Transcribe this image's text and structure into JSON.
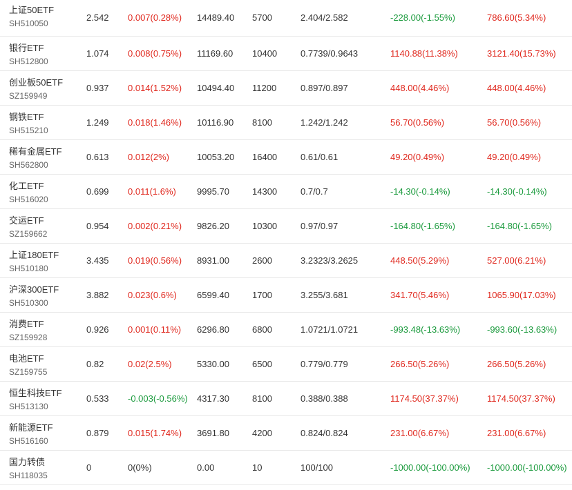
{
  "holdings": [
    {
      "name": "上证50ETF",
      "code": "SH510050",
      "price": "2.542",
      "change": "0.007(0.28%)",
      "change_dir": "up",
      "market_value": "14489.40",
      "quantity": "5700",
      "cost": "2.404/2.582",
      "profit_today": "-228.00(-1.55%)",
      "profit_today_dir": "down",
      "profit_total": "786.60(5.34%)",
      "profit_total_dir": "up"
    },
    {
      "name": "银行ETF",
      "code": "SH512800",
      "price": "1.074",
      "change": "0.008(0.75%)",
      "change_dir": "up",
      "market_value": "11169.60",
      "quantity": "10400",
      "cost": "0.7739/0.9643",
      "profit_today": "1140.88(11.38%)",
      "profit_today_dir": "up",
      "profit_total": "3121.40(15.73%)",
      "profit_total_dir": "up"
    },
    {
      "name": "创业板50ETF",
      "code": "SZ159949",
      "price": "0.937",
      "change": "0.014(1.52%)",
      "change_dir": "up",
      "market_value": "10494.40",
      "quantity": "11200",
      "cost": "0.897/0.897",
      "profit_today": "448.00(4.46%)",
      "profit_today_dir": "up",
      "profit_total": "448.00(4.46%)",
      "profit_total_dir": "up"
    },
    {
      "name": "钢铁ETF",
      "code": "SH515210",
      "price": "1.249",
      "change": "0.018(1.46%)",
      "change_dir": "up",
      "market_value": "10116.90",
      "quantity": "8100",
      "cost": "1.242/1.242",
      "profit_today": "56.70(0.56%)",
      "profit_today_dir": "up",
      "profit_total": "56.70(0.56%)",
      "profit_total_dir": "up"
    },
    {
      "name": "稀有金属ETF",
      "code": "SH562800",
      "price": "0.613",
      "change": "0.012(2%)",
      "change_dir": "up",
      "market_value": "10053.20",
      "quantity": "16400",
      "cost": "0.61/0.61",
      "profit_today": "49.20(0.49%)",
      "profit_today_dir": "up",
      "profit_total": "49.20(0.49%)",
      "profit_total_dir": "up"
    },
    {
      "name": "化工ETF",
      "code": "SH516020",
      "price": "0.699",
      "change": "0.011(1.6%)",
      "change_dir": "up",
      "market_value": "9995.70",
      "quantity": "14300",
      "cost": "0.7/0.7",
      "profit_today": "-14.30(-0.14%)",
      "profit_today_dir": "down",
      "profit_total": "-14.30(-0.14%)",
      "profit_total_dir": "down"
    },
    {
      "name": "交运ETF",
      "code": "SZ159662",
      "price": "0.954",
      "change": "0.002(0.21%)",
      "change_dir": "up",
      "market_value": "9826.20",
      "quantity": "10300",
      "cost": "0.97/0.97",
      "profit_today": "-164.80(-1.65%)",
      "profit_today_dir": "down",
      "profit_total": "-164.80(-1.65%)",
      "profit_total_dir": "down"
    },
    {
      "name": "上证180ETF",
      "code": "SH510180",
      "price": "3.435",
      "change": "0.019(0.56%)",
      "change_dir": "up",
      "market_value": "8931.00",
      "quantity": "2600",
      "cost": "3.2323/3.2625",
      "profit_today": "448.50(5.29%)",
      "profit_today_dir": "up",
      "profit_total": "527.00(6.21%)",
      "profit_total_dir": "up"
    },
    {
      "name": "沪深300ETF",
      "code": "SH510300",
      "price": "3.882",
      "change": "0.023(0.6%)",
      "change_dir": "up",
      "market_value": "6599.40",
      "quantity": "1700",
      "cost": "3.255/3.681",
      "profit_today": "341.70(5.46%)",
      "profit_today_dir": "up",
      "profit_total": "1065.90(17.03%)",
      "profit_total_dir": "up"
    },
    {
      "name": "消费ETF",
      "code": "SZ159928",
      "price": "0.926",
      "change": "0.001(0.11%)",
      "change_dir": "up",
      "market_value": "6296.80",
      "quantity": "6800",
      "cost": "1.0721/1.0721",
      "profit_today": "-993.48(-13.63%)",
      "profit_today_dir": "down",
      "profit_total": "-993.60(-13.63%)",
      "profit_total_dir": "down"
    },
    {
      "name": "电池ETF",
      "code": "SZ159755",
      "price": "0.82",
      "change": "0.02(2.5%)",
      "change_dir": "up",
      "market_value": "5330.00",
      "quantity": "6500",
      "cost": "0.779/0.779",
      "profit_today": "266.50(5.26%)",
      "profit_today_dir": "up",
      "profit_total": "266.50(5.26%)",
      "profit_total_dir": "up"
    },
    {
      "name": "恒生科技ETF",
      "code": "SH513130",
      "price": "0.533",
      "change": "-0.003(-0.56%)",
      "change_dir": "down",
      "market_value": "4317.30",
      "quantity": "8100",
      "cost": "0.388/0.388",
      "profit_today": "1174.50(37.37%)",
      "profit_today_dir": "up",
      "profit_total": "1174.50(37.37%)",
      "profit_total_dir": "up"
    },
    {
      "name": "新能源ETF",
      "code": "SH516160",
      "price": "0.879",
      "change": "0.015(1.74%)",
      "change_dir": "up",
      "market_value": "3691.80",
      "quantity": "4200",
      "cost": "0.824/0.824",
      "profit_today": "231.00(6.67%)",
      "profit_today_dir": "up",
      "profit_total": "231.00(6.67%)",
      "profit_total_dir": "up"
    },
    {
      "name": "国力转债",
      "code": "SH118035",
      "price": "0",
      "change": "0(0%)",
      "change_dir": "flat",
      "market_value": "0.00",
      "quantity": "10",
      "cost": "100/100",
      "profit_today": "-1000.00(-100.00%)",
      "profit_today_dir": "down",
      "profit_total": "-1000.00(-100.00%)",
      "profit_total_dir": "down"
    }
  ],
  "colors": {
    "up": "#e0281e",
    "down": "#1a9a3c",
    "text": "#333333",
    "code": "#666666",
    "divider": "#e8e8e8"
  }
}
